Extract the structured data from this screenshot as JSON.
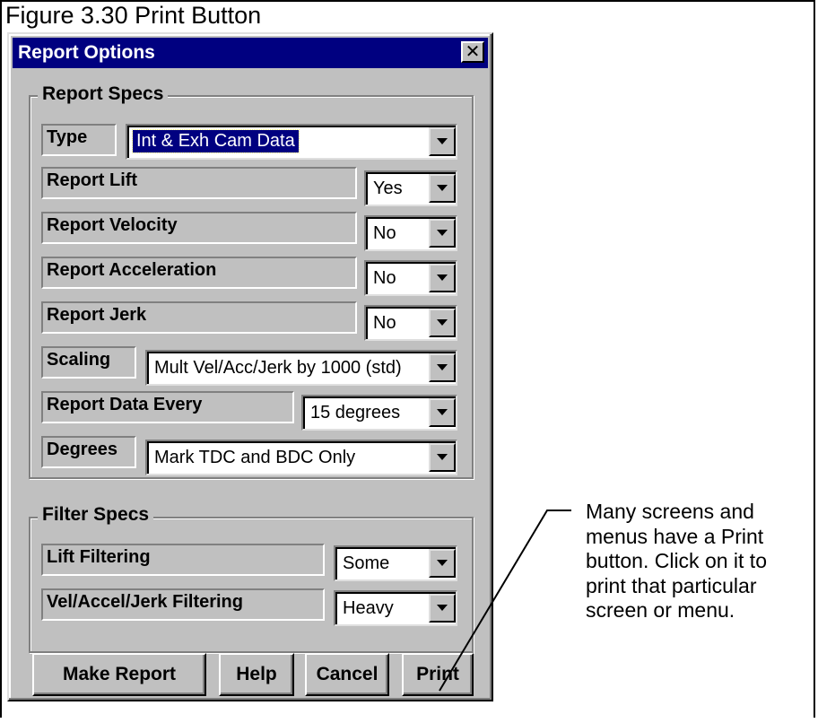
{
  "figure": {
    "caption": "Figure 3.30  Print Button",
    "callout": "Many screens and menus have a Print button.  Click on it to print that particular screen or menu."
  },
  "dialog": {
    "title": "Report Options",
    "close_glyph": "✕",
    "report_specs": {
      "title": "Report Specs",
      "type": {
        "label": "Type",
        "value": "Int & Exh Cam Data"
      },
      "report_lift": {
        "label": "Report Lift",
        "value": "Yes"
      },
      "report_velocity": {
        "label": "Report Velocity",
        "value": "No"
      },
      "report_acceleration": {
        "label": "Report Acceleration",
        "value": "No"
      },
      "report_jerk": {
        "label": "Report Jerk",
        "value": "No"
      },
      "scaling": {
        "label": "Scaling",
        "value": "Mult Vel/Acc/Jerk by 1000 (std)"
      },
      "report_data_every": {
        "label": "Report Data Every",
        "value": "15 degrees"
      },
      "degrees": {
        "label": "Degrees",
        "value": "Mark TDC and BDC Only"
      }
    },
    "filter_specs": {
      "title": "Filter Specs",
      "lift_filtering": {
        "label": "Lift Filtering",
        "value": "Some"
      },
      "vel_accel_jerk_filtering": {
        "label": "Vel/Accel/Jerk Filtering",
        "value": "Heavy"
      }
    },
    "buttons": {
      "make_report": "Make Report",
      "help": "Help",
      "cancel": "Cancel",
      "print": "Print"
    }
  },
  "colors": {
    "titlebar": "#000080",
    "dialog_face": "#c0c0c0",
    "selection": "#000080"
  }
}
